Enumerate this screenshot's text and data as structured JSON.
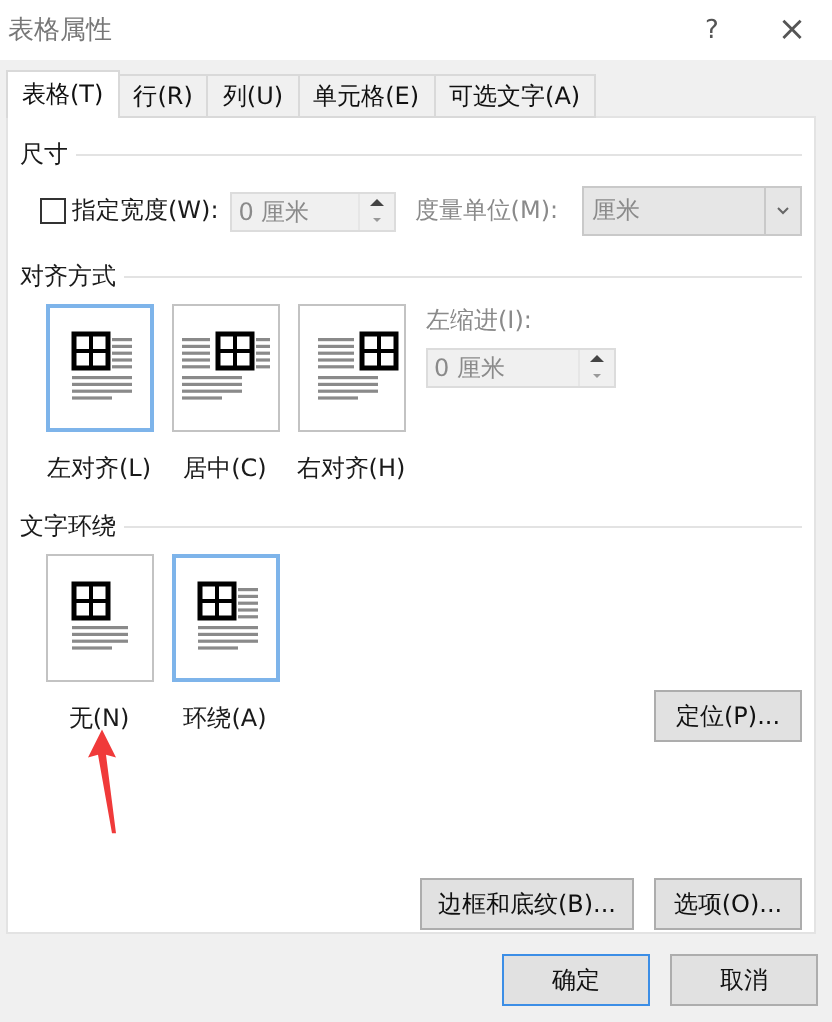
{
  "window": {
    "title": "表格属性",
    "help": "?",
    "close": "×"
  },
  "tabs": [
    {
      "label": "表格(T)",
      "selected": true
    },
    {
      "label": "行(R)",
      "selected": false
    },
    {
      "label": "列(U)",
      "selected": false
    },
    {
      "label": "单元格(E)",
      "selected": false
    },
    {
      "label": "可选文字(A)",
      "selected": false
    }
  ],
  "size_section": {
    "title": "尺寸",
    "width_checkbox": {
      "label": "指定宽度(W):",
      "checked": false
    },
    "width_field": {
      "value": "0 厘米",
      "disabled": true
    },
    "unit_label": "度量单位(M):",
    "unit_select": {
      "value": "厘米",
      "disabled": true
    }
  },
  "alignment_section": {
    "title": "对齐方式",
    "options": [
      {
        "label": "左对齐(L)",
        "kind": "left",
        "selected": true
      },
      {
        "label": "居中(C)",
        "kind": "center",
        "selected": false
      },
      {
        "label": "右对齐(H)",
        "kind": "right",
        "selected": false
      }
    ],
    "indent_label": "左缩进(I):",
    "indent_field": {
      "value": "0 厘米",
      "disabled": true
    }
  },
  "wrapping_section": {
    "title": "文字环绕",
    "options": [
      {
        "label": "无(N)",
        "kind": "none",
        "selected": false
      },
      {
        "label": "环绕(A)",
        "kind": "around",
        "selected": true
      }
    ],
    "position_button": "定位(P)..."
  },
  "buttons": [
    "边框和底纹(B)...",
    "选项(O)..."
  ],
  "footer_buttons": [
    {
      "label": "确定",
      "default": true
    },
    {
      "label": "取消",
      "default": false
    }
  ],
  "annotation": {
    "kind": "arrow",
    "color": "#f03a3a"
  }
}
